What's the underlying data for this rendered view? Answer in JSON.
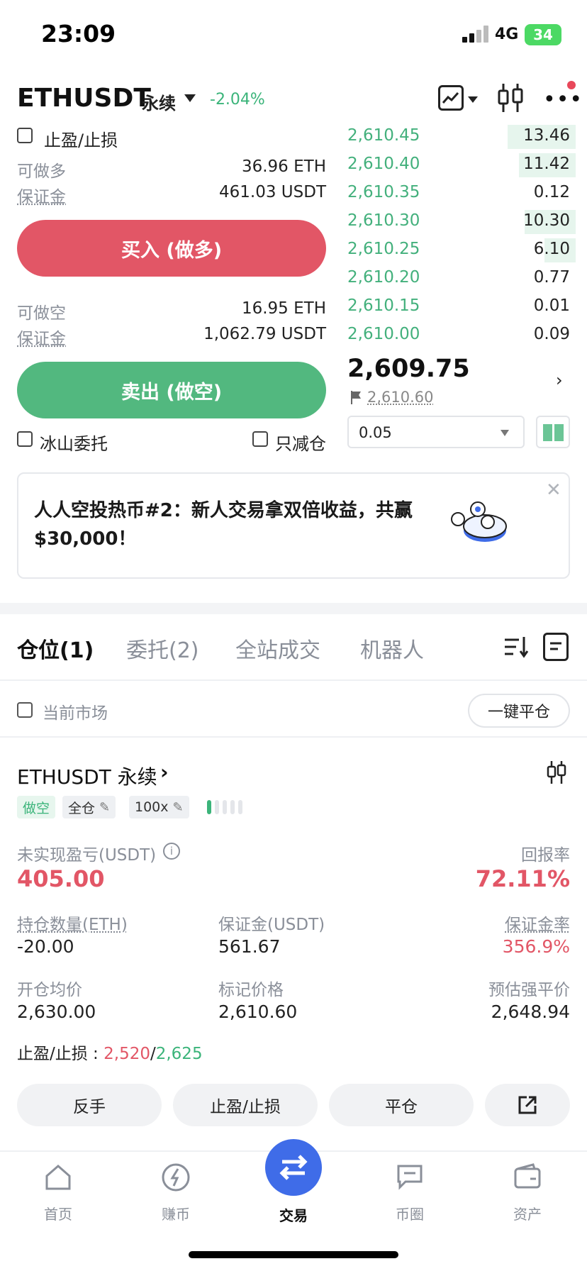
{
  "status_bar": {
    "time": "23:09",
    "network": "4G",
    "battery": "34"
  },
  "header": {
    "symbol": "ETHUSDT",
    "contract_type": "永续",
    "change": "-2.04%",
    "change_color": "#3bb47a"
  },
  "trade_panel": {
    "tp_sl_checkbox": "止盈/止损",
    "long_available_label": "可做多",
    "long_available_value": "36.96 ETH",
    "long_margin_label": "保证金",
    "long_margin_value": "461.03 USDT",
    "buy_label": "买入 (做多)",
    "short_available_label": "可做空",
    "short_available_value": "16.95 ETH",
    "short_margin_label": "保证金",
    "short_margin_value": "1,062.79 USDT",
    "sell_label": "卖出 (做空)",
    "iceberg_label": "冰山委托",
    "reduce_only_label": "只减仓",
    "buy_color": "#e25666",
    "sell_color": "#52b87f"
  },
  "order_book": {
    "rows": [
      {
        "price": "2,610.45",
        "qty": "13.46"
      },
      {
        "price": "2,610.40",
        "qty": "11.42"
      },
      {
        "price": "2,610.35",
        "qty": "0.12"
      },
      {
        "price": "2,610.30",
        "qty": "10.30"
      },
      {
        "price": "2,610.25",
        "qty": "6.10"
      },
      {
        "price": "2,610.20",
        "qty": "0.77"
      },
      {
        "price": "2,610.15",
        "qty": "0.01"
      },
      {
        "price": "2,610.00",
        "qty": "0.09"
      }
    ],
    "last_price": "2,609.75",
    "mark_price": "2,610.60",
    "depth_step": "0.05"
  },
  "banner": {
    "text": "人人空投热币#2：新人交易拿双倍收益，共赢$30,000！"
  },
  "tabs": [
    {
      "label": "仓位(1)",
      "active": true
    },
    {
      "label": "委托(2)",
      "active": false
    },
    {
      "label": "全站成交",
      "active": false
    },
    {
      "label": "机器人",
      "active": false
    }
  ],
  "filter": {
    "current_market_label": "当前市场",
    "close_all_label": "一键平仓"
  },
  "position": {
    "title": "ETHUSDT 永续",
    "side_tag": "做空",
    "margin_mode_tag": "全仓",
    "leverage_tag": "100x",
    "unrealized_pnl_label": "未实现盈亏(USDT)",
    "unrealized_pnl": "405.00",
    "roe_label": "回报率",
    "roe": "72.11%",
    "size_label": "持仓数量(ETH)",
    "size": "-20.00",
    "margin_label": "保证金(USDT)",
    "margin": "561.67",
    "margin_ratio_label": "保证金率",
    "margin_ratio": "356.9%",
    "entry_label": "开仓均价",
    "entry": "2,630.00",
    "mark_label": "标记价格",
    "mark": "2,610.60",
    "liq_label": "预估强平价",
    "liq": "2,648.94",
    "tpsl_label": "止盈/止损 : ",
    "tp": "2,520",
    "sep": "/",
    "sl": "2,625"
  },
  "actions": {
    "reverse": "反手",
    "tpsl": "止盈/止损",
    "close": "平仓"
  },
  "bottom_nav": [
    {
      "label": "首页",
      "icon": "home-icon"
    },
    {
      "label": "赚币",
      "icon": "earn-icon"
    },
    {
      "label": "交易",
      "icon": "trade-icon"
    },
    {
      "label": "币圈",
      "icon": "community-icon"
    },
    {
      "label": "资产",
      "icon": "wallet-icon"
    }
  ]
}
